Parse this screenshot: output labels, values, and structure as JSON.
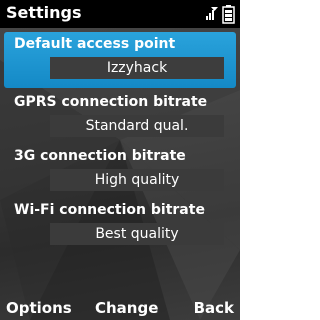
{
  "header": {
    "title": "Settings",
    "signal_icon": "network-signal-icon",
    "battery_icon": "battery-icon"
  },
  "settings": [
    {
      "label": "Default access point",
      "value": "Izzyhack",
      "selected": true
    },
    {
      "label": "GPRS connection bitrate",
      "value": "Standard qual.",
      "selected": false
    },
    {
      "label": "3G connection bitrate",
      "value": "High quality",
      "selected": false
    },
    {
      "label": "Wi-Fi connection bitrate",
      "value": "Best quality",
      "selected": false
    }
  ],
  "softkeys": {
    "left": "Options",
    "middle": "Change",
    "right": "Back"
  },
  "colors": {
    "highlight": "#1a93d0",
    "status_bar": "#000000",
    "value_box": "#3b3b3b"
  }
}
